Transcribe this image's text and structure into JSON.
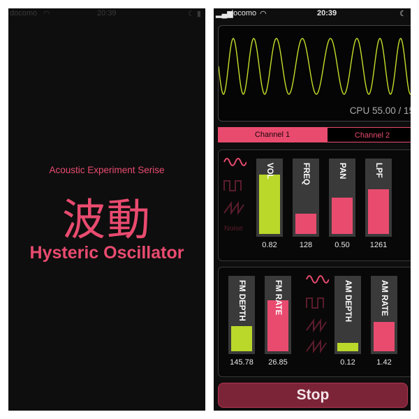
{
  "splash": {
    "status": {
      "carrier": "docomo",
      "time": "20:39"
    },
    "tagline": "Acoustic Experiment Serise",
    "kanji": "波動",
    "app_name": "Hysteric Oscillator"
  },
  "app": {
    "status": {
      "carrier": "docomo",
      "time": "20:39"
    },
    "scope": {
      "cpu_text": "CPU 55.00 / 15",
      "waveform_color": "#c6dd2a"
    },
    "tabs": [
      {
        "label": "Channel 1",
        "active": true
      },
      {
        "label": "Channel 2",
        "active": false
      }
    ],
    "channel": {
      "waveforms": [
        "sine",
        "square",
        "sawtooth",
        "Noise"
      ],
      "noise_label": "Noise",
      "sliders": [
        {
          "label": "VOL",
          "value": "0.82",
          "level": 0.82,
          "color": "#b9d82a"
        },
        {
          "label": "FREQ",
          "value": "128",
          "level": 0.28,
          "color": "#e94b6f"
        },
        {
          "label": "PAN",
          "value": "0.50",
          "level": 0.5,
          "color": "#e94b6f"
        },
        {
          "label": "LPF",
          "value": "1261",
          "level": 0.62,
          "color": "#e94b6f"
        }
      ]
    },
    "modulation": {
      "sliders_left": [
        {
          "label": "FM DEPTH",
          "value": "145.78",
          "level": 0.35,
          "color": "#b9d82a"
        },
        {
          "label": "FM RATE",
          "value": "26.85",
          "level": 0.7,
          "color": "#e94b6f"
        }
      ],
      "sliders_right": [
        {
          "label": "AM DEPTH",
          "value": "0.12",
          "level": 0.12,
          "color": "#b9d82a"
        },
        {
          "label": "AM RATE",
          "value": "1.42",
          "level": 0.4,
          "color": "#e94b6f"
        }
      ]
    },
    "stop_label": "Stop",
    "colors": {
      "accent": "#e94b6f",
      "lime": "#b9d82a",
      "background": "#0e0e0e"
    }
  }
}
